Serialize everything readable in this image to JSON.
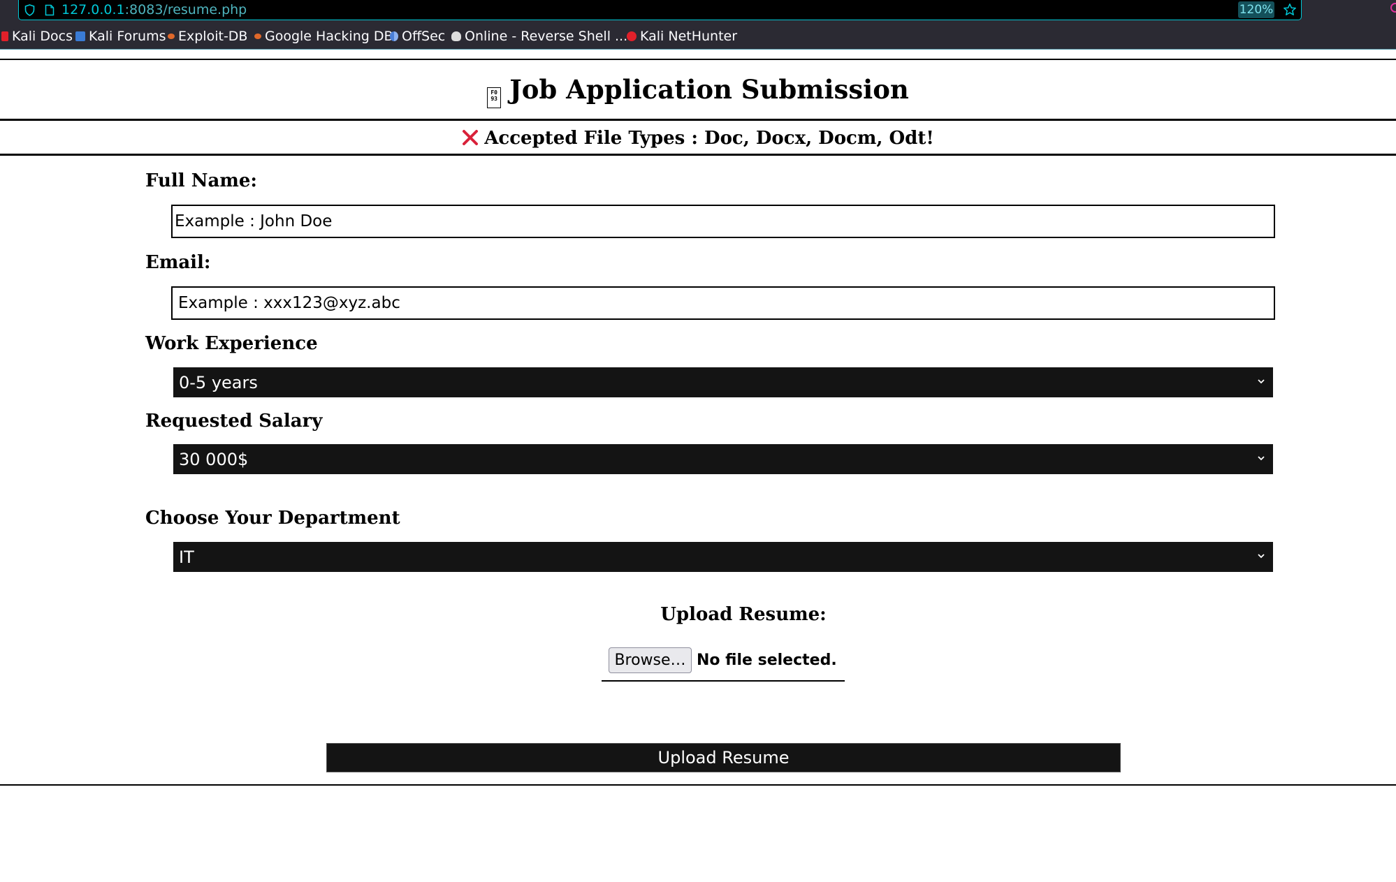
{
  "browser": {
    "url_host": "127.0.0.1",
    "url_path": ":8083/resume.php",
    "zoom": "120%",
    "bookmarks": [
      {
        "label": "Kali Docs",
        "icon": "kali-docs-icon",
        "color": "#e0202a"
      },
      {
        "label": "Kali Forums",
        "icon": "kali-forums-icon",
        "color": "#3a7bd5"
      },
      {
        "label": "Exploit-DB",
        "icon": "exploit-db-icon",
        "color": "#e0682a"
      },
      {
        "label": "Google Hacking DB",
        "icon": "ghdb-icon",
        "color": "#e0682a"
      },
      {
        "label": "OffSec",
        "icon": "offsec-icon",
        "color": "#4a7fd8"
      },
      {
        "label": "Online - Reverse Shell ...",
        "icon": "skull-icon",
        "color": "#dddddd"
      },
      {
        "label": "Kali NetHunter",
        "icon": "nethunter-icon",
        "color": "#e0202a"
      }
    ]
  },
  "page": {
    "title": "Job Application Submission",
    "title_glyph": "F0 93",
    "accepted_types": "Accepted File Types : Doc, Docx, Docm, Odt!",
    "accent_red": "#d9213a"
  },
  "form": {
    "full_name": {
      "label": "Full Name:",
      "placeholder": "Example : John Doe"
    },
    "email": {
      "label": "Email:",
      "placeholder": "Example : xxx123@xyz.abc"
    },
    "experience": {
      "label": "Work Experience",
      "selected": "0-5 years"
    },
    "salary": {
      "label": "Requested Salary",
      "selected": "30 000$"
    },
    "department": {
      "label": "Choose Your Department",
      "selected": "IT"
    },
    "upload": {
      "label": "Upload Resume:",
      "browse": "Browse…",
      "status": "No file selected."
    },
    "submit": "Upload Resume"
  }
}
